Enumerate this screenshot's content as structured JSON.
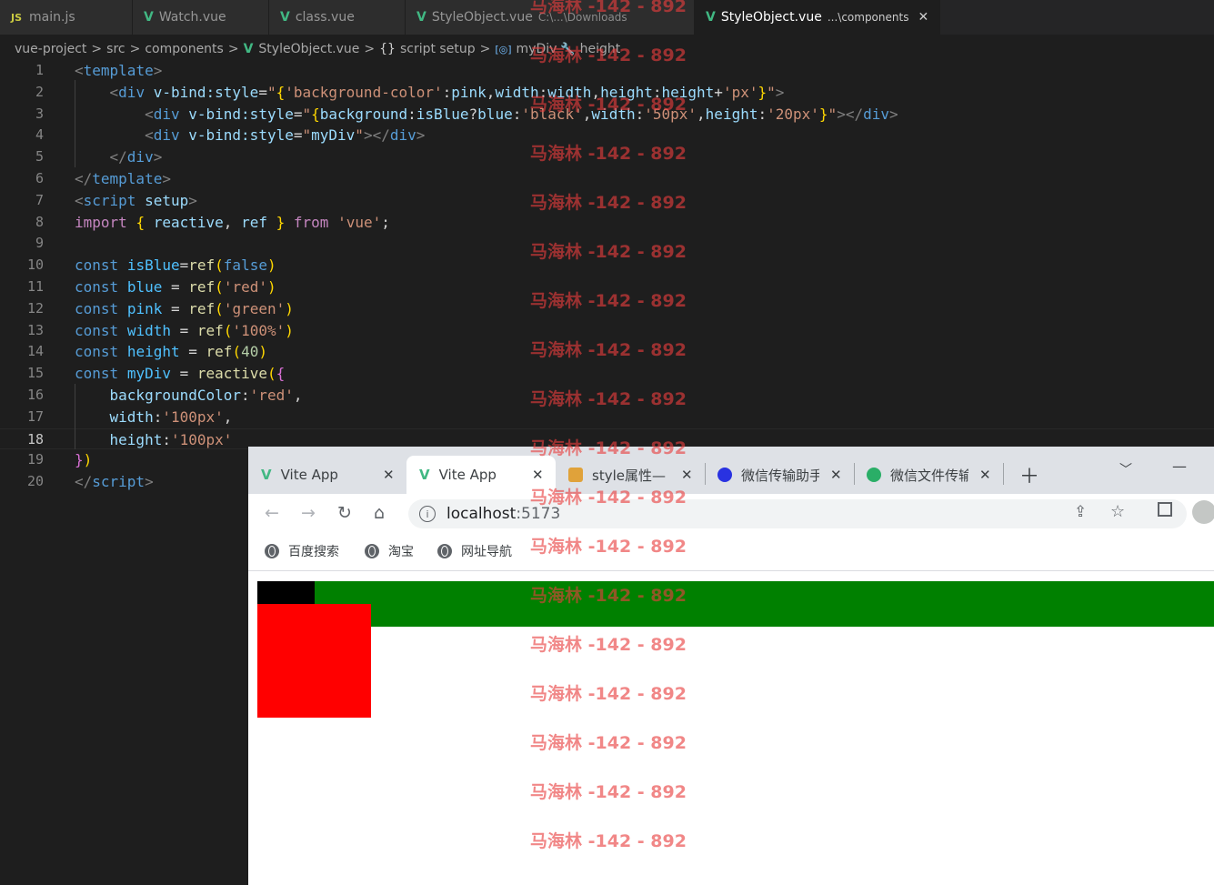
{
  "editor_tabs": [
    {
      "icon": "JS",
      "label": "main.js",
      "desc": "",
      "active": false
    },
    {
      "icon": "V",
      "label": "Watch.vue",
      "desc": "",
      "active": false
    },
    {
      "icon": "V",
      "label": "class.vue",
      "desc": "",
      "active": false
    },
    {
      "icon": "V",
      "label": "StyleObject.vue",
      "desc": "C:\\...\\Downloads",
      "active": false
    },
    {
      "icon": "V",
      "label": "StyleObject.vue",
      "desc": "...\\components",
      "active": true
    }
  ],
  "breadcrumb": {
    "items": [
      "vue-project",
      "src",
      "components",
      "StyleObject.vue",
      "script setup",
      "myDiv",
      "height"
    ],
    "braces": "{}",
    "sep": ">"
  },
  "code_lines": [
    {
      "n": "1",
      "html": "<span class='t-br'>&lt;</span><span class='t-tag'>template</span><span class='t-br'>&gt;</span>"
    },
    {
      "n": "2",
      "html": "    <span class='t-br'>&lt;</span><span class='t-tag'>div</span> <span class='t-attr'>v-bind:style</span><span class='t-txt'>=</span><span class='t-str'>\"</span><span class='t-y'>{</span><span class='t-str'>'background-color'</span><span class='t-txt'>:</span><span class='t-attr'>pink</span><span class='t-txt'>,</span><span class='t-attr'>width</span><span class='t-txt'>:</span><span class='t-attr'>width</span><span class='t-txt'>,</span><span class='t-attr'>height</span><span class='t-txt'>:</span><span class='t-attr'>height</span><span class='t-txt'>+</span><span class='t-str'>'px'</span><span class='t-y'>}</span><span class='t-str'>\"</span><span class='t-br'>&gt;</span>"
    },
    {
      "n": "3",
      "html": "        <span class='t-br'>&lt;</span><span class='t-tag'>div</span> <span class='t-attr'>v-bind:style</span><span class='t-txt'>=</span><span class='t-str'>\"</span><span class='t-y'>{</span><span class='t-attr'>background</span><span class='t-txt'>:</span><span class='t-attr'>isBlue</span><span class='t-txt'>?</span><span class='t-attr'>blue</span><span class='t-txt'>:</span><span class='t-str'>'black'</span><span class='t-txt'>,</span><span class='t-attr'>width</span><span class='t-txt'>:</span><span class='t-str'>'50px'</span><span class='t-txt'>,</span><span class='t-attr'>height</span><span class='t-txt'>:</span><span class='t-str'>'20px'</span><span class='t-y'>}</span><span class='t-str'>\"</span><span class='t-br'>&gt;&lt;/</span><span class='t-tag'>div</span><span class='t-br'>&gt;</span>"
    },
    {
      "n": "4",
      "html": "        <span class='t-br'>&lt;</span><span class='t-tag'>div</span> <span class='t-attr'>v-bind:style</span><span class='t-txt'>=</span><span class='t-str'>\"</span><span class='t-attr'>myDiv</span><span class='t-str'>\"</span><span class='t-br'>&gt;&lt;/</span><span class='t-tag'>div</span><span class='t-br'>&gt;</span>"
    },
    {
      "n": "5",
      "html": "    <span class='t-br'>&lt;/</span><span class='t-tag'>div</span><span class='t-br'>&gt;</span>"
    },
    {
      "n": "6",
      "html": "<span class='t-br'>&lt;/</span><span class='t-tag'>template</span><span class='t-br'>&gt;</span>"
    },
    {
      "n": "7",
      "html": "<span class='t-br'>&lt;</span><span class='t-tag'>script</span> <span class='t-attr'>setup</span><span class='t-br'>&gt;</span>"
    },
    {
      "n": "8",
      "html": "<span class='t-imp'>import</span> <span class='t-y'>{</span> <span class='t-attr'>reactive</span><span class='t-txt'>,</span> <span class='t-attr'>ref</span> <span class='t-y'>}</span> <span class='t-imp'>from</span> <span class='t-str'>'vue'</span><span class='t-txt'>;</span>"
    },
    {
      "n": "9",
      "html": ""
    },
    {
      "n": "10",
      "html": "<span class='t-kw'>const</span> <span class='t-var'>isBlue</span><span class='t-txt'>=</span><span class='t-fn'>ref</span><span class='t-y'>(</span><span class='t-kw'>false</span><span class='t-y'>)</span>"
    },
    {
      "n": "11",
      "html": "<span class='t-kw'>const</span> <span class='t-var'>blue</span> <span class='t-txt'>=</span> <span class='t-fn'>ref</span><span class='t-y'>(</span><span class='t-str'>'red'</span><span class='t-y'>)</span>"
    },
    {
      "n": "12",
      "html": "<span class='t-kw'>const</span> <span class='t-var'>pink</span> <span class='t-txt'>=</span> <span class='t-fn'>ref</span><span class='t-y'>(</span><span class='t-str'>'green'</span><span class='t-y'>)</span>"
    },
    {
      "n": "13",
      "html": "<span class='t-kw'>const</span> <span class='t-var'>width</span> <span class='t-txt'>=</span> <span class='t-fn'>ref</span><span class='t-y'>(</span><span class='t-str'>'100%'</span><span class='t-y'>)</span>"
    },
    {
      "n": "14",
      "html": "<span class='t-kw'>const</span> <span class='t-var'>height</span> <span class='t-txt'>=</span> <span class='t-fn'>ref</span><span class='t-y'>(</span><span class='t-num'>40</span><span class='t-y'>)</span>"
    },
    {
      "n": "15",
      "html": "<span class='t-kw'>const</span> <span class='t-var'>myDiv</span> <span class='t-txt'>=</span> <span class='t-fn'>reactive</span><span class='t-y'>(</span><span class='t-p'>{</span>"
    },
    {
      "n": "16",
      "html": "    <span class='t-attr'>backgroundColor</span><span class='t-txt'>:</span><span class='t-str'>'red'</span><span class='t-txt'>,</span>"
    },
    {
      "n": "17",
      "html": "    <span class='t-attr'>width</span><span class='t-txt'>:</span><span class='t-str'>'100px'</span><span class='t-txt'>,</span>"
    },
    {
      "n": "18",
      "html": "    <span class='t-attr'>height</span><span class='t-txt'>:</span><span class='t-str'>'100px'</span>"
    },
    {
      "n": "19",
      "html": "<span class='t-p'>}</span><span class='t-y'>)</span>"
    },
    {
      "n": "20",
      "html": "<span class='t-br'>&lt;/</span><span class='t-tag'>script</span><span class='t-br'>&gt;</span>"
    }
  ],
  "current_line": "18",
  "browser": {
    "tabs": [
      {
        "label": "Vite App",
        "favicon": "vite-icon",
        "active": false
      },
      {
        "label": "Vite App",
        "favicon": "vite-icon",
        "active": true
      },
      {
        "label": "style属性—",
        "favicon": "tiger-icon",
        "active": false
      },
      {
        "label": "微信传输助手",
        "favicon": "baidu-paw-icon",
        "active": false
      },
      {
        "label": "微信文件传输",
        "favicon": "wechat-icon",
        "active": false
      }
    ],
    "url_host": "localhost",
    "url_port": ":5173",
    "bookmarks": [
      "百度搜索",
      "淘宝",
      "网址导航"
    ]
  },
  "preview": {
    "outer_color": "#008000",
    "inner1_color": "#000000",
    "inner2_color": "#ff0000"
  },
  "watermark_text": "马海林 -142 - 892"
}
